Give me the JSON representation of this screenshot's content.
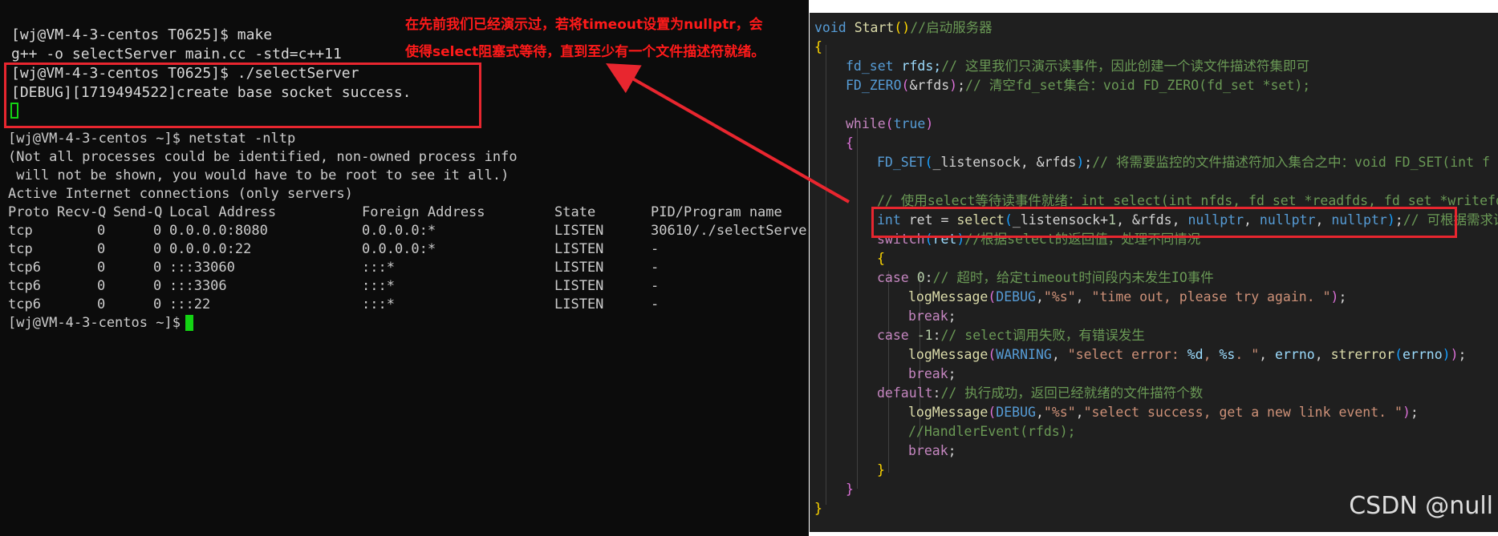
{
  "terminal": {
    "lines": [
      "[wj@VM-4-3-centos T0625]$ make",
      "g++ -o selectServer main.cc -std=c++11",
      "[wj@VM-4-3-centos T0625]$ ./selectServer",
      "[DEBUG][1719494522]create base socket success.",
      "[wj@VM-4-3-centos ~]$ netstat -nltp",
      "(Not all processes could be identified, non-owned process info",
      " will not be shown, you would have to be root to see it all.)",
      "Active Internet connections (only servers)",
      "[wj@VM-4-3-centos ~]$ "
    ],
    "netstat_header": {
      "proto": "Proto",
      "recvq": "Recv-Q",
      "sendq": "Send-Q",
      "local": "Local Address",
      "foreign": "Foreign Address",
      "state": "State",
      "pid": "PID/Program name"
    },
    "netstat_rows": [
      {
        "proto": "tcp",
        "recvq": "0",
        "sendq": "0",
        "local": "0.0.0.0:8080",
        "foreign": "0.0.0.0:*",
        "state": "LISTEN",
        "pid": "30610/./selectServe"
      },
      {
        "proto": "tcp",
        "recvq": "0",
        "sendq": "0",
        "local": "0.0.0.0:22",
        "foreign": "0.0.0.0:*",
        "state": "LISTEN",
        "pid": "-"
      },
      {
        "proto": "tcp6",
        "recvq": "0",
        "sendq": "0",
        "local": ":::33060",
        "foreign": ":::*",
        "state": "LISTEN",
        "pid": "-"
      },
      {
        "proto": "tcp6",
        "recvq": "0",
        "sendq": "0",
        "local": ":::3306",
        "foreign": ":::*",
        "state": "LISTEN",
        "pid": "-"
      },
      {
        "proto": "tcp6",
        "recvq": "0",
        "sendq": "0",
        "local": ":::22",
        "foreign": ":::*",
        "state": "LISTEN",
        "pid": "-"
      }
    ]
  },
  "annotation": {
    "line1": "在先前我们已经演示过，若将timeout设置为nullptr，会",
    "line2": "使得select阻塞式等待，直到至少有一个文件描述符就绪。"
  },
  "code": {
    "l1_kw": "void",
    "l1_fn": "Start",
    "l1_comment": "//启动服务器",
    "l3_type": "fd_set",
    "l3_var": " rfds;",
    "l3_comment": "// 这里我们只演示读事件，因此创建一个读文件描述符集即可",
    "l4_mac": "FD_ZERO",
    "l4_arg": "&rfds",
    "l4_comment": "// 清空fd_set集合：void FD_ZERO(fd_set *set);",
    "l6_kw": "while",
    "l6_val": "true",
    "l8_mac": "FD_SET",
    "l8_args": "_listensock, &rfds",
    "l8_comment": "// 将需要监控的文件描述符加入集合之中：void FD_SET(int f",
    "l10_comment": "// 使用select等待读事件就绪：int select(int nfds, fd_set *readfds, fd_set *writefd",
    "l11_type": "int",
    "l11_var": " ret = ",
    "l11_fn": "select",
    "l11_a": "_listensock+",
    "l11_num": "1",
    "l11_b": ", &rfds, ",
    "l11_null1": "nullptr",
    "l11_null2": "nullptr",
    "l11_null3": "nullptr",
    "l11_comment": "// 可根据需求设置",
    "l12_kw": "switch",
    "l12_var": "ret",
    "l12_comment": "//根据select的返回值，处理不同情况",
    "l14_kw": "case",
    "l14_num": "0",
    "l14_comment": "// 超时，给定timeout时间段内未发生IO事件",
    "l15_fn": "logMessage",
    "l15_mac": "DEBUG",
    "l15_s1": "\"%s\"",
    "l15_s2": "\"time out, please try again. \"",
    "l16_kw": "break",
    "l17_kw": "case",
    "l17_num": "-1",
    "l17_comment": "// select调用失败，有错误发生",
    "l18_fn": "logMessage",
    "l18_mac": "WARNING",
    "l18_s1a": "\"select error: ",
    "l18_fmt1": "%d",
    "l18_s1b": ", ",
    "l18_fmt2": "%s",
    "l18_s1c": ". \"",
    "l18_v1": "errno",
    "l18_fn2": "strerror",
    "l18_v2": "errno",
    "l19_kw": "break",
    "l20_kw": "default",
    "l20_comment": "// 执行成功，返回已经就绪的文件描符个数",
    "l21_fn": "logMessage",
    "l21_mac": "DEBUG",
    "l21_s1": "\"%s\"",
    "l21_s2": "\"select success, get a new link event. \"",
    "l22_comment": "//HandlerEvent(rfds);",
    "l23_kw": "break"
  },
  "watermark": "CSDN @null",
  "colors": {
    "highlight_box": "#e8262f",
    "annotation_text": "#ff1a1a",
    "cursor": "#13d313"
  }
}
